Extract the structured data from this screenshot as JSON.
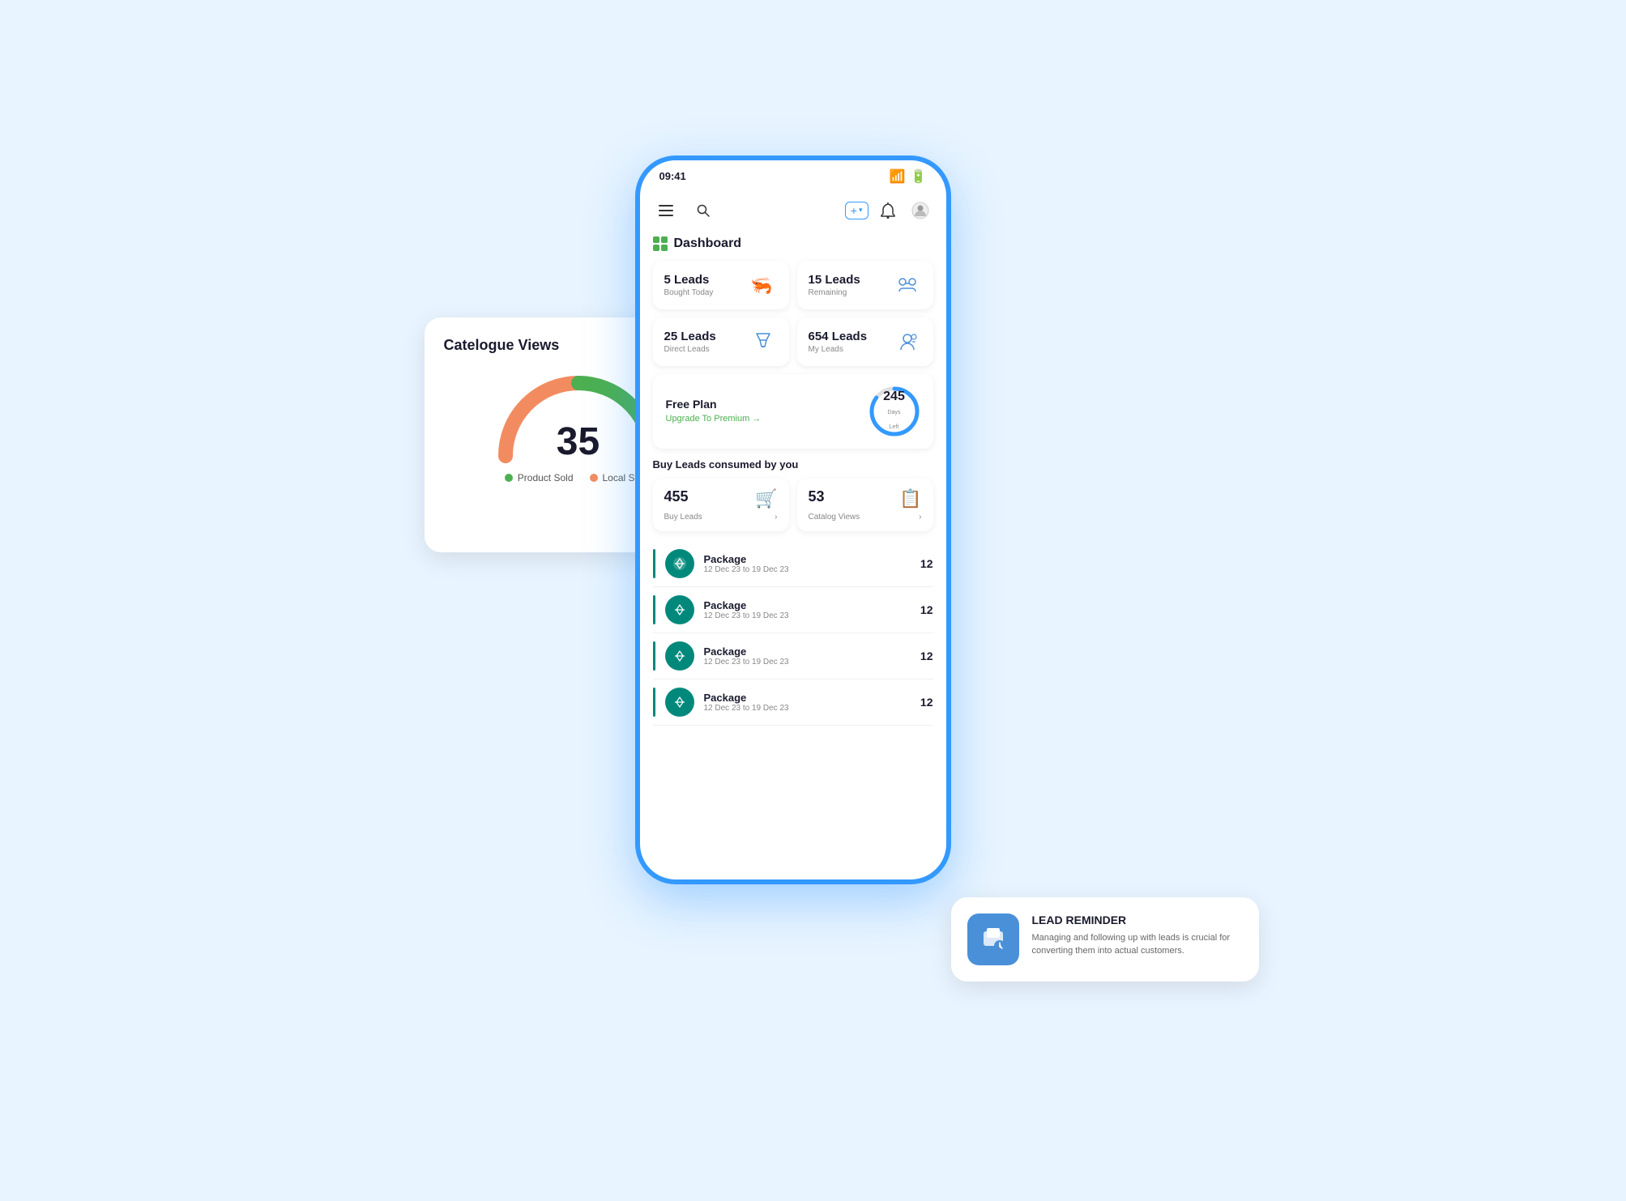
{
  "phone": {
    "time": "09:41",
    "header": {
      "add_label": "+ ∨",
      "bell_label": "🔔",
      "user_label": "👤"
    },
    "dashboard_title": "Dashboard",
    "stats": [
      {
        "number": "5 Leads",
        "label": "Bought Today",
        "icon": "shrimp"
      },
      {
        "number": "15 Leads",
        "label": "Remaining",
        "icon": "link"
      },
      {
        "number": "25 Leads",
        "label": "Direct Leads",
        "icon": "funnel"
      },
      {
        "number": "654 Leads",
        "label": "My Leads",
        "icon": "gear-person"
      }
    ],
    "plan": {
      "title": "Free Plan",
      "cta": "Upgrade To Premium →",
      "days": "245",
      "days_label": "Days Left"
    },
    "consumed_title": "Buy Leads consumed by you",
    "actions": [
      {
        "number": "455",
        "label": "Buy Leads",
        "icon": "🛒"
      },
      {
        "number": "53",
        "label": "Catalog Views",
        "icon": "📋"
      }
    ],
    "packages": [
      {
        "name": "Package",
        "date": "12 Dec 23 to 19 Dec 23",
        "count": "12"
      },
      {
        "name": "Package",
        "date": "12 Dec 23 to 19 Dec 23",
        "count": "12"
      },
      {
        "name": "Package",
        "date": "12 Dec 23 to 19 Dec 23",
        "count": "12"
      },
      {
        "name": "Package",
        "date": "12 Dec 23 to 19 Dec 23",
        "count": "12"
      }
    ]
  },
  "catalogue": {
    "title": "Catelogue Views",
    "number": "35",
    "legend": [
      {
        "label": "Product Sold",
        "color": "#4CAF50"
      },
      {
        "label": "Local Store",
        "color": "#f28c60"
      }
    ]
  },
  "reminder": {
    "title": "LEAD REMINDER",
    "body": "Managing and following up with leads is crucial for converting them into actual customers."
  }
}
